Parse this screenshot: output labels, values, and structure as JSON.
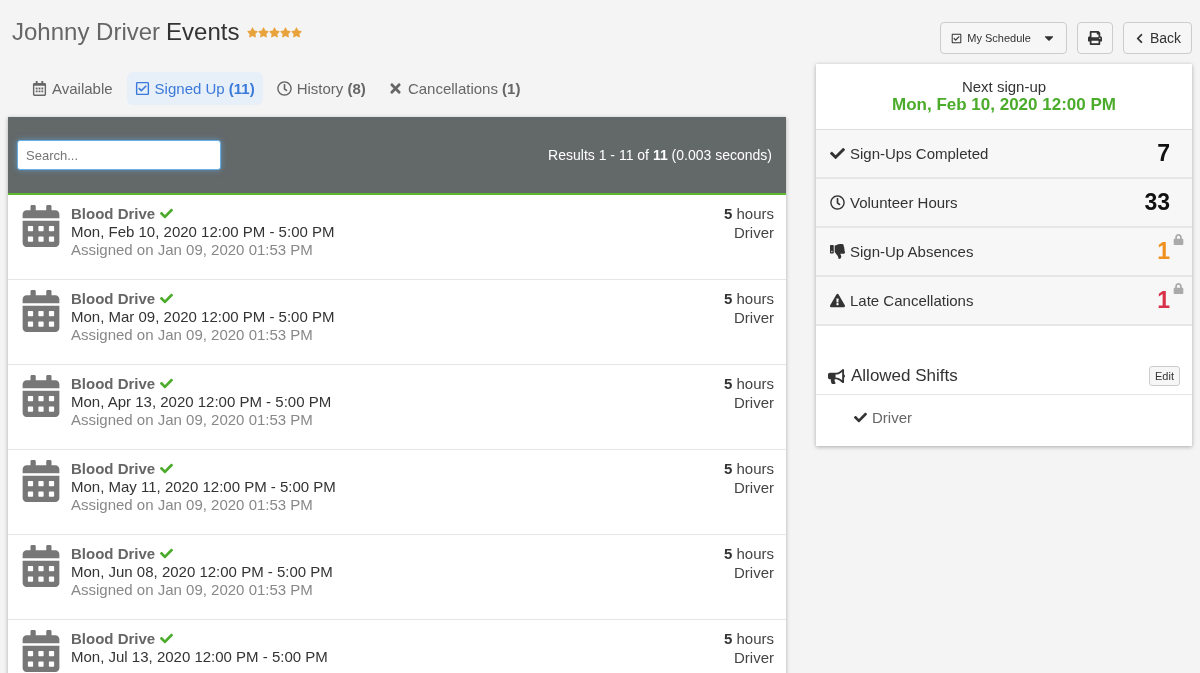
{
  "header": {
    "name": "Johnny Driver",
    "title": "Events",
    "stars": 5
  },
  "toolbar": {
    "schedule_button": "My Schedule",
    "back_button": "Back"
  },
  "tabs": [
    {
      "kind": "calendar",
      "label": "Available",
      "selected": false
    },
    {
      "kind": "check-square",
      "label": "Signed Up **(11)**",
      "selected": true
    },
    {
      "kind": "clock",
      "label": "History **(8)**",
      "selected": false
    },
    {
      "kind": "times",
      "label": "Cancellations **(1)**",
      "selected": false
    }
  ],
  "list": {
    "search": {
      "placeholder": "Search..."
    },
    "results": "Results 1 - 11 of **11** (0.003 seconds)",
    "events": [
      {
        "title": "Blood Drive",
        "confirmed": true,
        "date": "Mon, Feb 10, 2020 12:00 PM - 5:00 PM",
        "assigned": "Assigned on Jan 09, 2020 01:53 PM",
        "hours": "**5** hours",
        "role": "Driver"
      },
      {
        "title": "Blood Drive",
        "confirmed": true,
        "date": "Mon, Mar 09, 2020 12:00 PM - 5:00 PM",
        "assigned": "Assigned on Jan 09, 2020 01:53 PM",
        "hours": "**5** hours",
        "role": "Driver"
      },
      {
        "title": "Blood Drive",
        "confirmed": true,
        "date": "Mon, Apr 13, 2020 12:00 PM - 5:00 PM",
        "assigned": "Assigned on Jan 09, 2020 01:53 PM",
        "hours": "**5** hours",
        "role": "Driver"
      },
      {
        "title": "Blood Drive",
        "confirmed": true,
        "date": "Mon, May 11, 2020 12:00 PM - 5:00 PM",
        "assigned": "Assigned on Jan 09, 2020 01:53 PM",
        "hours": "**5** hours",
        "role": "Driver"
      },
      {
        "title": "Blood Drive",
        "confirmed": true,
        "date": "Mon, Jun 08, 2020 12:00 PM - 5:00 PM",
        "assigned": "Assigned on Jan 09, 2020 01:53 PM",
        "hours": "**5** hours",
        "role": "Driver"
      },
      {
        "title": "Blood Drive",
        "confirmed": true,
        "date": "Mon, Jul 13, 2020 12:00 PM - 5:00 PM",
        "hours": "**5** hours",
        "role": "Driver"
      }
    ]
  },
  "summary": {
    "next_label": "Next sign-up",
    "next_date": "Mon, Feb 10, 2020 12:00 PM",
    "stats": [
      {
        "kind": "check",
        "label": "Sign-Ups Completed",
        "value": "7",
        "color": "#111111",
        "locked": false
      },
      {
        "kind": "clock",
        "label": "Volunteer Hours",
        "value": "33",
        "color": "#111111",
        "locked": false
      },
      {
        "kind": "thumbs-down",
        "label": "Sign-Up Absences",
        "value": "1",
        "color": "#f0901e",
        "locked": true
      },
      {
        "kind": "warning",
        "label": "Late Cancellations",
        "value": "1",
        "color": "#d9304a",
        "locked": true
      }
    ],
    "shifts": {
      "title": "Allowed Shifts",
      "edit_button": "Edit",
      "items": [
        {
          "label": "Driver",
          "checked": true
        }
      ]
    }
  }
}
